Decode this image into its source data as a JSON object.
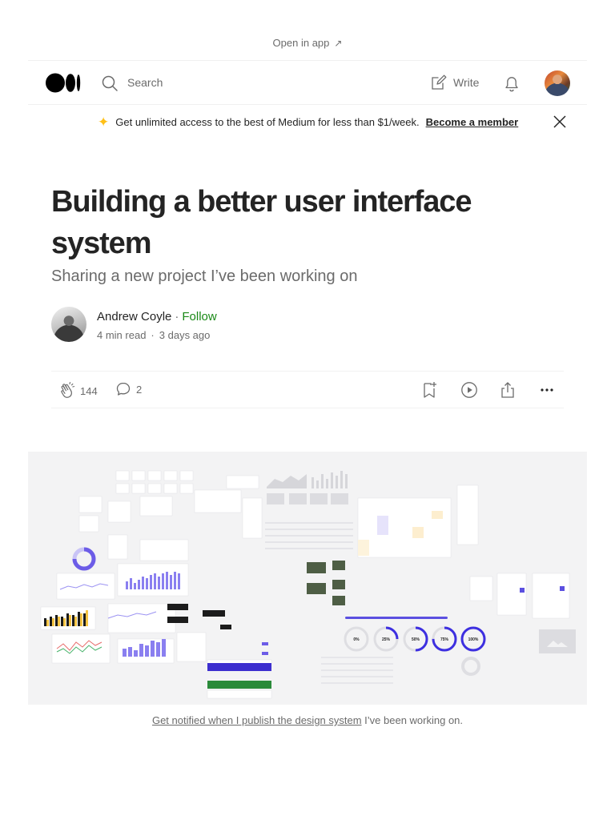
{
  "top": {
    "open_in_app": "Open in app"
  },
  "nav": {
    "search_placeholder": "Search",
    "write_label": "Write"
  },
  "banner": {
    "text": "Get unlimited access to the best of Medium for less than $1/week.",
    "cta": "Become a member"
  },
  "article": {
    "title": "Building a better user interface system",
    "subtitle": "Sharing a new project I’ve been working on",
    "author": "Andrew Coyle",
    "follow": "Follow",
    "read_time": "4 min read",
    "date": "3 days ago",
    "claps": "144",
    "responses": "2"
  },
  "figure": {
    "progress_labels": [
      "0%",
      "25%",
      "50%",
      "75%",
      "100%"
    ],
    "progress_values": [
      0,
      0.25,
      0.5,
      0.75,
      1.0
    ],
    "caption_link": "Get notified when I publish the design system",
    "caption_rest": " I’ve been working on."
  },
  "colors": {
    "accent": "#1a8917",
    "brand_purple": "#5b4fe0",
    "text": "#242424",
    "muted": "#6b6b6b",
    "star": "#ffc017"
  }
}
